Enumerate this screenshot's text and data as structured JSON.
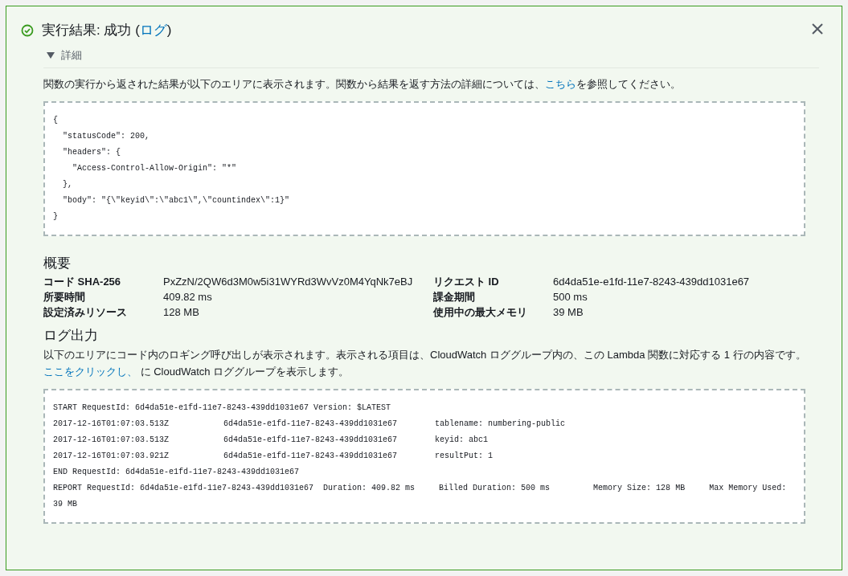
{
  "result": {
    "success": true,
    "title_prefix": "実行結果: 成功 (",
    "title_link": "ログ",
    "title_suffix": ")"
  },
  "details": {
    "label": "詳細",
    "expanded": true
  },
  "description": {
    "before": "関数の実行から返された結果が以下のエリアに表示されます。関数から結果を返す方法の詳細については、",
    "link": "こちら",
    "after": "を参照してください。"
  },
  "result_lines": [
    "{",
    "  \"statusCode\": 200,",
    "  \"headers\": {",
    "    \"Access-Control-Allow-Origin\": \"*\"",
    "  },",
    "  \"body\": \"{\\\"keyid\\\":\\\"abc1\\\",\\\"countindex\\\":1}\"",
    "}"
  ],
  "summary": {
    "heading": "概要",
    "fields": [
      {
        "label": "コード SHA-256",
        "value": "PxZzN/2QW6d3M0w5i31WYRd3WvVz0M4YqNk7eBJ"
      },
      {
        "label": "リクエスト ID",
        "value": "6d4da51e-e1fd-11e7-8243-439dd1031e67"
      },
      {
        "label": "所要時間",
        "value": "409.82 ms"
      },
      {
        "label": "課金期間",
        "value": "500 ms"
      },
      {
        "label": "設定済みリソース",
        "value": "128 MB"
      },
      {
        "label": "使用中の最大メモリ",
        "value": "39 MB"
      }
    ]
  },
  "log_output": {
    "heading": "ログ出力",
    "description": {
      "before": "以下のエリアにコード内のロギング呼び出しが表示されます。表示される項目は、CloudWatch ロググループ内の、この Lambda 関数に対応する 1 行の内容です。",
      "link": "ここをクリックし、",
      "after": " に CloudWatch ロググループを表示します。"
    },
    "lines": [
      {
        "kind": "plain",
        "text": "START RequestId: 6d4da51e-e1fd-11e7-8243-439dd1031e67 Version: $LATEST"
      },
      {
        "kind": "entry",
        "timestamp": "2017-12-16T01:07:03.513Z",
        "request_id": "6d4da51e-e1fd-11e7-8243-439dd1031e67",
        "message": "tablename: numbering-public"
      },
      {
        "kind": "entry",
        "timestamp": "2017-12-16T01:07:03.513Z",
        "request_id": "6d4da51e-e1fd-11e7-8243-439dd1031e67",
        "message": "keyid: abc1"
      },
      {
        "kind": "entry",
        "timestamp": "2017-12-16T01:07:03.921Z",
        "request_id": "6d4da51e-e1fd-11e7-8243-439dd1031e67",
        "message": "resultPut: 1"
      },
      {
        "kind": "plain",
        "text": "END RequestId: 6d4da51e-e1fd-11e7-8243-439dd1031e67"
      },
      {
        "kind": "plain",
        "text": "REPORT RequestId: 6d4da51e-e1fd-11e7-8243-439dd1031e67  Duration: 409.82 ms     Billed Duration: 500 ms         Memory Size: 128 MB     Max Memory Used: 39 MB"
      }
    ]
  }
}
